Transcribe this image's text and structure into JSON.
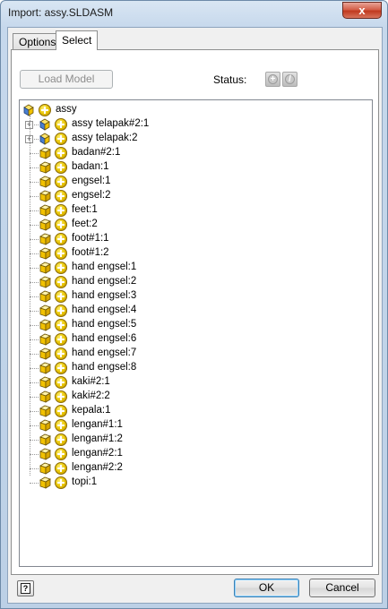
{
  "window": {
    "title": "Import:  assy.SLDASM",
    "close_glyph": "x"
  },
  "tabs": [
    {
      "label": "Options"
    },
    {
      "label": "Select"
    }
  ],
  "toolbar": {
    "load_model_label": "Load Model",
    "status_label": "Status:"
  },
  "tree": {
    "root": "assy",
    "subassemblies": [
      "assy telapak#2:1",
      "assy telapak:2"
    ],
    "parts": [
      "badan#2:1",
      "badan:1",
      "engsel:1",
      "engsel:2",
      "feet:1",
      "feet:2",
      "foot#1:1",
      "foot#1:2",
      "hand engsel:1",
      "hand engsel:2",
      "hand engsel:3",
      "hand engsel:4",
      "hand engsel:5",
      "hand engsel:6",
      "hand engsel:7",
      "hand engsel:8",
      "kaki#2:1",
      "kaki#2:2",
      "kepala:1",
      "lengan#1:1",
      "lengan#1:2",
      "lengan#2:1",
      "lengan#2:2",
      "topi:1"
    ]
  },
  "footer": {
    "help_glyph": "?",
    "ok_label": "OK",
    "cancel_label": "Cancel"
  },
  "icons": {
    "cube_color": "#f2c200",
    "assembly_blue": "#4a7fd0",
    "plus_badge": "add-icon",
    "status_add": "add-icon",
    "status_forbid": "forbid-icon"
  }
}
